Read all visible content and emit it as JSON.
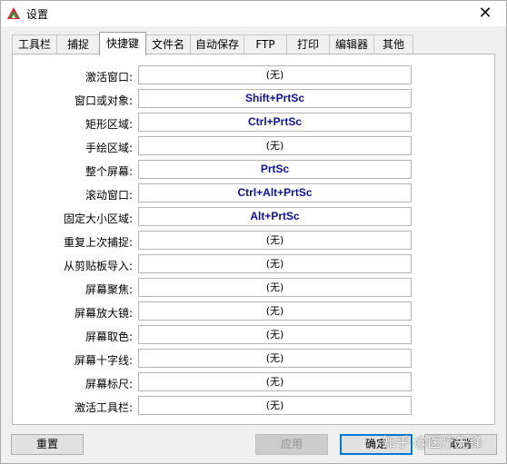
{
  "window": {
    "title": "设置",
    "close_glyph": "✕"
  },
  "tabs": [
    {
      "label": "工具栏",
      "active": false
    },
    {
      "label": "捕捉",
      "active": false
    },
    {
      "label": "快捷键",
      "active": true
    },
    {
      "label": "文件名",
      "active": false
    },
    {
      "label": "自动保存",
      "active": false
    },
    {
      "label": "FTP",
      "active": false
    },
    {
      "label": "打印",
      "active": false
    },
    {
      "label": "编辑器",
      "active": false
    },
    {
      "label": "其他",
      "active": false
    }
  ],
  "hotkeys": [
    {
      "label": "激活窗口:",
      "value": "(无)",
      "set": false
    },
    {
      "label": "窗口或对象:",
      "value": "Shift+PrtSc",
      "set": true
    },
    {
      "label": "矩形区域:",
      "value": "Ctrl+PrtSc",
      "set": true
    },
    {
      "label": "手绘区域:",
      "value": "(无)",
      "set": false
    },
    {
      "label": "整个屏幕:",
      "value": "PrtSc",
      "set": true
    },
    {
      "label": "滚动窗口:",
      "value": "Ctrl+Alt+PrtSc",
      "set": true
    },
    {
      "label": "固定大小区域:",
      "value": "Alt+PrtSc",
      "set": true
    },
    {
      "label": "重复上次捕捉:",
      "value": "(无)",
      "set": false
    },
    {
      "label": "从剪贴板导入:",
      "value": "(无)",
      "set": false
    },
    {
      "label": "屏幕聚焦:",
      "value": "(无)",
      "set": false
    },
    {
      "label": "屏幕放大镜:",
      "value": "(无)",
      "set": false
    },
    {
      "label": "屏幕取色:",
      "value": "(无)",
      "set": false
    },
    {
      "label": "屏幕十字线:",
      "value": "(无)",
      "set": false
    },
    {
      "label": "屏幕标尺:",
      "value": "(无)",
      "set": false
    },
    {
      "label": "激活工具栏:",
      "value": "(无)",
      "set": false
    }
  ],
  "buttons": {
    "reset": "重置",
    "apply": "应用",
    "ok": "确定",
    "cancel": "取消"
  },
  "watermark": "知乎 @医疗先锋",
  "colors": {
    "hotkey_text": "#10109a",
    "default_button_border": "#0078d7"
  }
}
